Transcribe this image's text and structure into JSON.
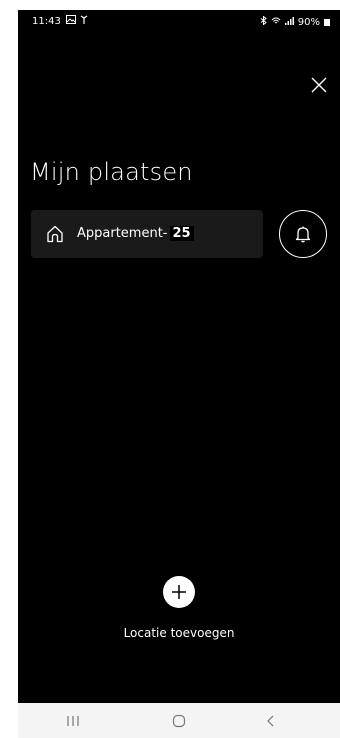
{
  "status_bar": {
    "time": "11:43",
    "battery": "90%",
    "icons": [
      "image-icon",
      "antenna-icon",
      "bluetooth-icon",
      "wifi-icon",
      "signal-icon",
      "battery-icon"
    ]
  },
  "header": {
    "close_icon": "close-icon"
  },
  "main": {
    "title": "Mijn plaatsen",
    "places": [
      {
        "name": "Appartement-",
        "number": "25",
        "icon": "home-icon"
      }
    ],
    "bell_icon": "bell-icon",
    "add_label": "Locatie toevoegen",
    "add_icon": "plus-icon"
  },
  "nav_bar": {
    "items": [
      "recent-apps-icon",
      "home-nav-icon",
      "back-icon"
    ]
  },
  "colors": {
    "background": "#000000",
    "card": "#1a1a1a",
    "text": "#ffffff",
    "nav_bar": "#f4f4f4"
  }
}
